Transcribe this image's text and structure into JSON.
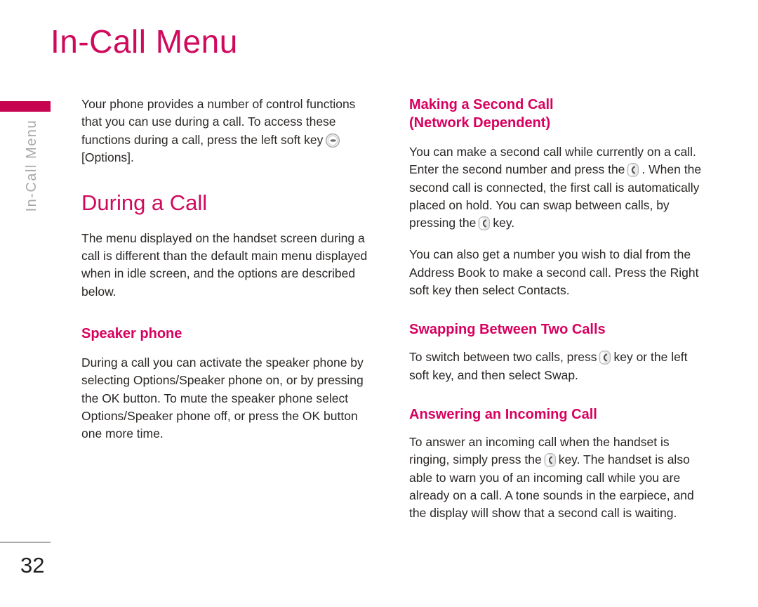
{
  "page": {
    "title": "In-Call Menu",
    "side_tab_label": "In-Call Menu",
    "page_number": "32",
    "accent_color": "#cf0a5c",
    "tab_color": "#c7044f",
    "side_label_color": "#a6a8ab",
    "body_color": "#2b2725"
  },
  "icons": {
    "left_soft_key": "left-soft-key-icon",
    "call_key": "call-send-key-icon"
  },
  "left_column": {
    "intro_part1": "Your phone provides a number of control functions that you can use during a call. To access these functions during a call, press the left soft key",
    "intro_part2": "[Options].",
    "heading": "During a Call",
    "heading_body": "The menu displayed on the handset screen during a call is different than the default main menu displayed when in idle screen, and the options are described below.",
    "subheading": "Speaker phone",
    "subheading_body": "During a call you can activate the speaker phone by selecting Options/Speaker phone on, or by pressing the OK button. To mute the speaker phone select Options/Speaker phone off, or press the OK button one more time."
  },
  "right_column": {
    "heading1_line1": "Making a Second Call",
    "heading1_line2": "(Network Dependent)",
    "para1_a": "You can make a second call while currently on a call. Enter the second number and press the",
    "para1_b": ". When the second call is connected, the first call is automatically placed on hold. You can swap between calls, by pressing the",
    "para1_c": "key.",
    "para2": "You can also get a number you wish to dial from the Address Book to make a second call. Press the Right soft key then select Contacts.",
    "heading2": "Swapping Between Two Calls",
    "para3_a": "To switch between two calls, press",
    "para3_b": "key or the left soft key, and then select Swap.",
    "heading3": "Answering an Incoming Call",
    "para4_a": "To answer an incoming call when the handset is ringing, simply press the",
    "para4_b": "key. The handset is also able to warn you of an incoming call while you are already on a call. A tone sounds in the earpiece, and the display will show that a second call is waiting."
  }
}
